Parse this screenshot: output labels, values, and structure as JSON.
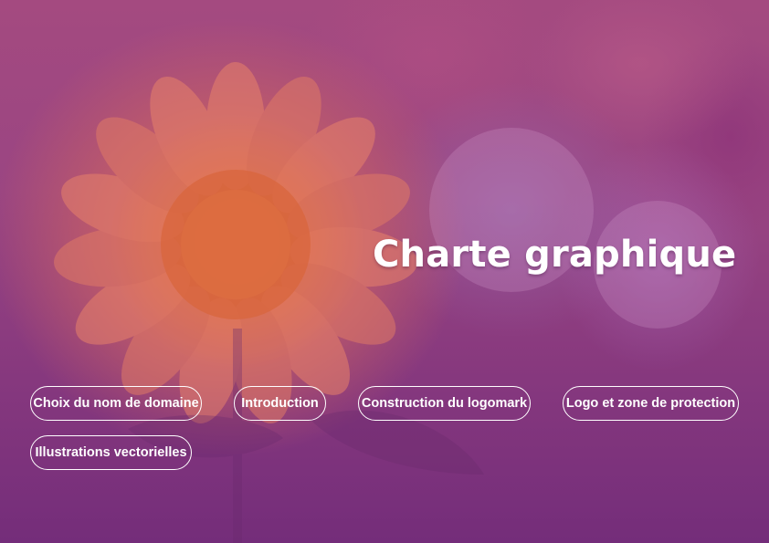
{
  "page": {
    "title": "Charte graphique"
  },
  "navigation": {
    "buttons": [
      {
        "label": "Choix du nom de domaine"
      },
      {
        "label": "Introduction"
      },
      {
        "label": "Construction du logomark"
      },
      {
        "label": "Logo et zone de protection"
      },
      {
        "label": "Illustrations vectorielles"
      }
    ]
  },
  "colors": {
    "overlay_top": "#a44a80",
    "overlay_bottom": "#742d7a",
    "flower_center": "#e2703f",
    "text": "#ffffff"
  }
}
